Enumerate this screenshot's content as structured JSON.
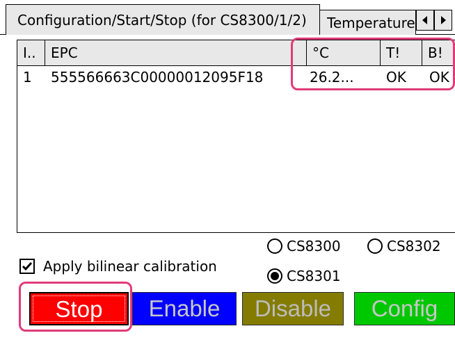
{
  "tabs": {
    "active": "Configuration/Start/Stop (for CS8300/1/2)",
    "next": "Temperature"
  },
  "list": {
    "columns": [
      "I..",
      "EPC",
      "°C",
      "T!",
      "B!"
    ],
    "rows": [
      {
        "index": "1",
        "epc": "555566663C00000012095F18",
        "temp": "26.2...",
        "t_flag": "OK",
        "b_flag": "OK"
      }
    ]
  },
  "models": {
    "cs8300": "CS8300",
    "cs8302": "CS8302",
    "cs8301": "CS8301",
    "selected": "CS8301"
  },
  "calibration": {
    "label": "Apply bilinear calibration",
    "checked": true
  },
  "buttons": {
    "stop": "Stop",
    "enable": "Enable",
    "disable": "Disable",
    "config": "Config"
  },
  "colors": {
    "highlight": "#e23a79",
    "stop": "#ff0000",
    "enable": "#0000ff",
    "disable": "#847c00",
    "config": "#00c800"
  }
}
